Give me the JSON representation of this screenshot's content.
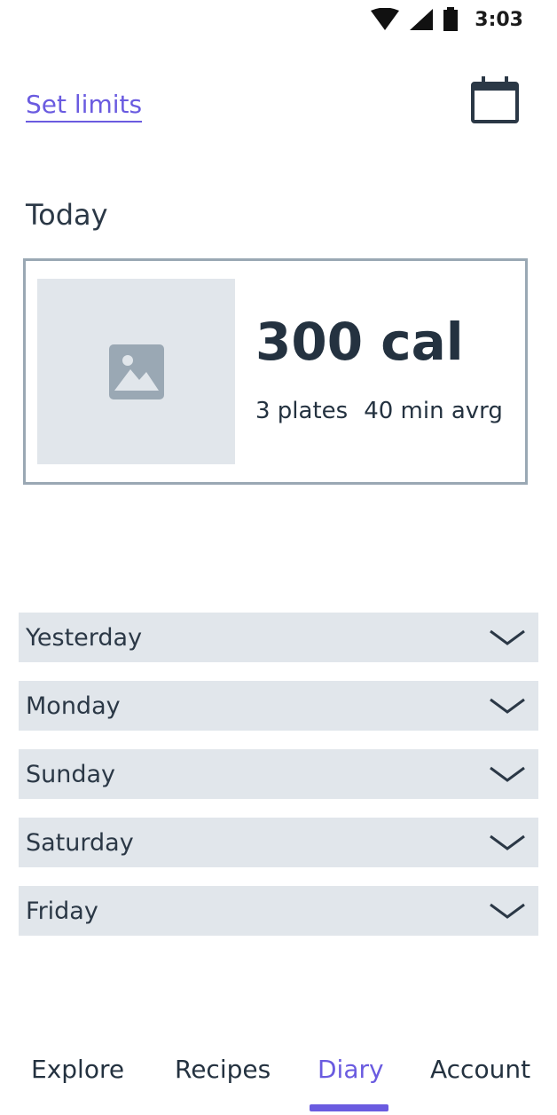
{
  "status_bar": {
    "time": "3:03",
    "icons": [
      "wifi-icon",
      "signal-icon",
      "battery-icon"
    ]
  },
  "header": {
    "set_limits_label": "Set limits",
    "calendar_icon": "calendar-icon"
  },
  "today": {
    "title": "Today",
    "calories": "300 cal",
    "plates": "3 plates",
    "avg_time": "40 min avrg",
    "image_icon": "image-placeholder-icon"
  },
  "days": [
    {
      "label": "Yesterday"
    },
    {
      "label": "Monday"
    },
    {
      "label": "Sunday"
    },
    {
      "label": "Saturday"
    },
    {
      "label": "Friday"
    }
  ],
  "nav": {
    "items": [
      {
        "label": "Explore"
      },
      {
        "label": "Recipes"
      },
      {
        "label": "Diary"
      },
      {
        "label": "Account"
      }
    ],
    "active": "Diary"
  },
  "colors": {
    "accent": "#6a5be0",
    "text": "#2b3846",
    "row_bg": "#e1e6eb",
    "card_border": "#9aa8b4"
  }
}
